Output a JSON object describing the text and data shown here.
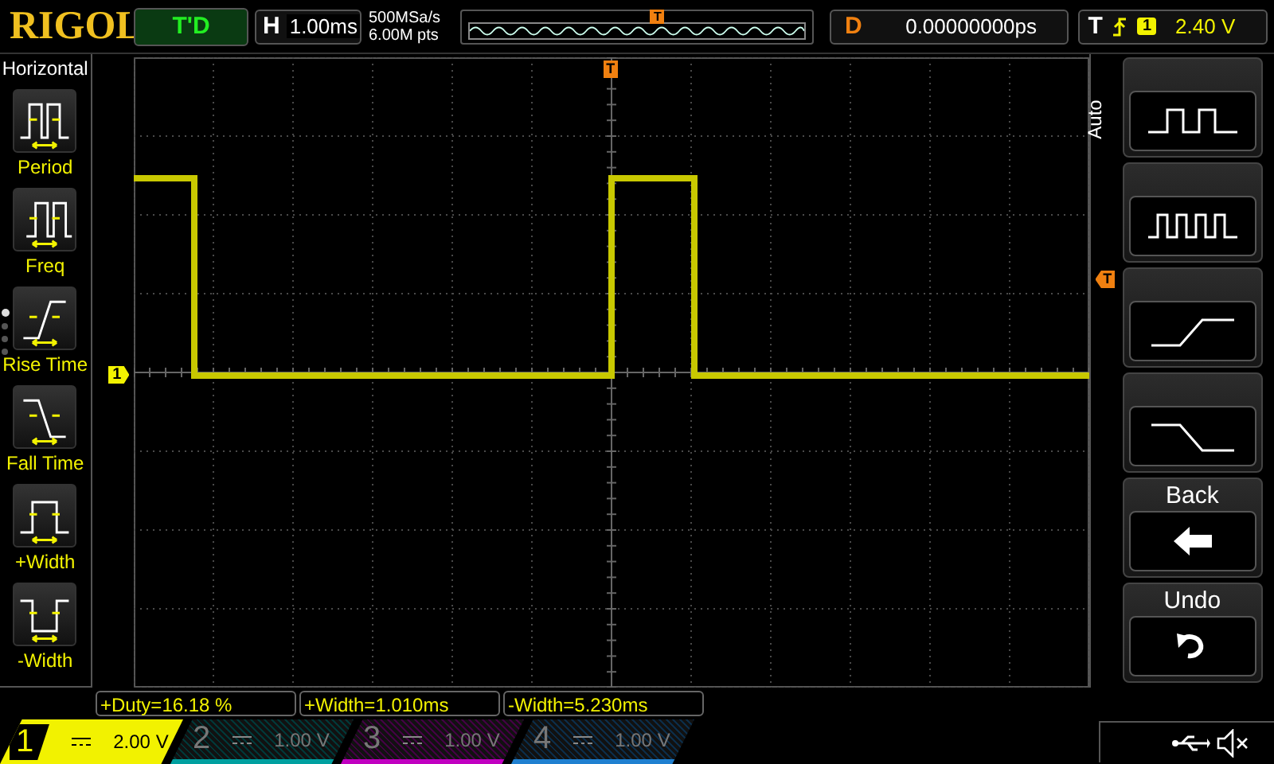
{
  "top_bar": {
    "logo": "RIGOL",
    "run_status": "T'D",
    "horizontal": {
      "label": "H",
      "timebase": "1.00ms"
    },
    "sample_rate": "500MSa/s",
    "memory_depth": "6.00M pts",
    "trigger_position_marker": "T",
    "delay": {
      "label": "D",
      "value": "0.00000000ps"
    },
    "trigger": {
      "label": "T",
      "source": "1",
      "level": "2.40 V"
    }
  },
  "left_menu": {
    "title": "Horizontal",
    "items": [
      {
        "kind": "period",
        "label": "Period"
      },
      {
        "kind": "freq",
        "label": "Freq"
      },
      {
        "kind": "rise",
        "label": "Rise Time"
      },
      {
        "kind": "fall",
        "label": "Fall Time"
      },
      {
        "kind": "pwidth",
        "label": "+Width"
      },
      {
        "kind": "nwidth",
        "label": "-Width"
      }
    ],
    "pages": [
      {
        "selected": true
      },
      {
        "selected": false
      },
      {
        "selected": false
      },
      {
        "selected": false
      }
    ]
  },
  "display": {
    "channel_marker": "1",
    "trigger_time_marker": "T",
    "trigger_level_marker": "T"
  },
  "right_menu": {
    "tab": "Auto",
    "keys": [
      {
        "kind": "wave-single"
      },
      {
        "kind": "wave-multi"
      },
      {
        "kind": "rise"
      },
      {
        "kind": "fall"
      },
      {
        "kind": "back",
        "label": "Back"
      },
      {
        "kind": "undo",
        "label": "Undo"
      }
    ]
  },
  "measurements": [
    "+Duty=16.18 %",
    "+Width=1.010ms",
    "-Width=5.230ms"
  ],
  "channels": [
    {
      "number": "1",
      "scale": "2.00 V",
      "active": true,
      "color": "#f2f200"
    },
    {
      "number": "2",
      "scale": "1.00 V",
      "active": false,
      "color": "#00a0a0"
    },
    {
      "number": "3",
      "scale": "1.00 V",
      "active": false,
      "color": "#c000c0"
    },
    {
      "number": "4",
      "scale": "1.00 V",
      "active": false,
      "color": "#2080d0"
    }
  ]
}
